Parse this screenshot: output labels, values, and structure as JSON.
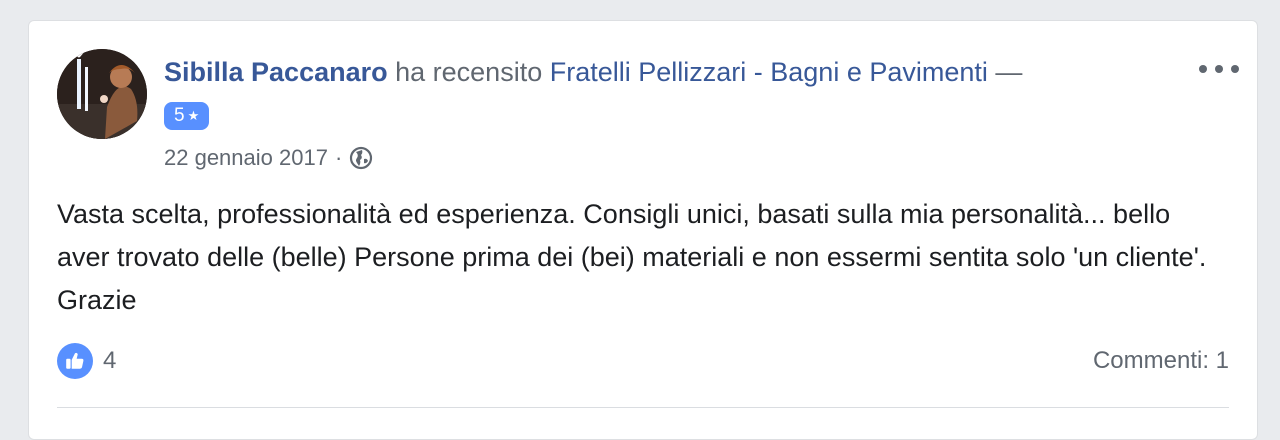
{
  "review": {
    "author": "Sibilla Paccanaro",
    "action": "ha recensito",
    "page": "Fratelli Pellizzari - Bagni e Pavimenti",
    "separator": "—",
    "rating": "5",
    "rating_icon": "star-icon",
    "date": "22 gennaio 2017",
    "date_separator": "·",
    "privacy_icon": "globe-icon",
    "text": "Vasta scelta, professionalità ed esperienza. Consigli unici, basati sulla mia personalità... bello aver trovato delle (belle) Persone prima dei (bei) materiali e non essermi sentita solo 'un cliente'. Grazie"
  },
  "footer": {
    "like_count": "4",
    "comments_label": "Commenti: 1"
  },
  "colors": {
    "link": "#385898",
    "badge": "#5890ff",
    "meta": "#606770",
    "body_text": "#1c1e21"
  }
}
